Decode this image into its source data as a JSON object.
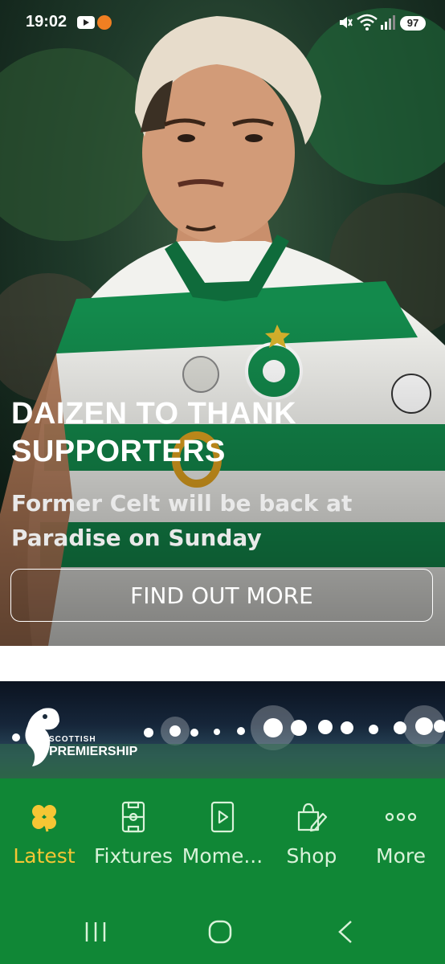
{
  "status_bar": {
    "time": "19:02",
    "battery": "97"
  },
  "hero": {
    "title": "DAIZEN TO THANK SUPPORTERS",
    "subtitle": "Former Celt will be back at Paradise on Sunday",
    "cta_label": "FIND OUT MORE"
  },
  "banner2": {
    "logo_small": "SCOTTISH",
    "logo_big": "PREMIERSHIP"
  },
  "bottom_nav": {
    "items": [
      {
        "label": "Latest",
        "icon": "clover-icon",
        "active": true
      },
      {
        "label": "Fixtures",
        "icon": "pitch-icon",
        "active": false
      },
      {
        "label": "Mome...",
        "icon": "play-icon",
        "active": false
      },
      {
        "label": "Shop",
        "icon": "shopping-bag-icon",
        "active": false
      },
      {
        "label": "More",
        "icon": "more-dots-icon",
        "active": false
      }
    ]
  },
  "colors": {
    "nav_background": "#108736",
    "active_accent": "#f5c634",
    "nav_text": "#d9f2d9"
  }
}
